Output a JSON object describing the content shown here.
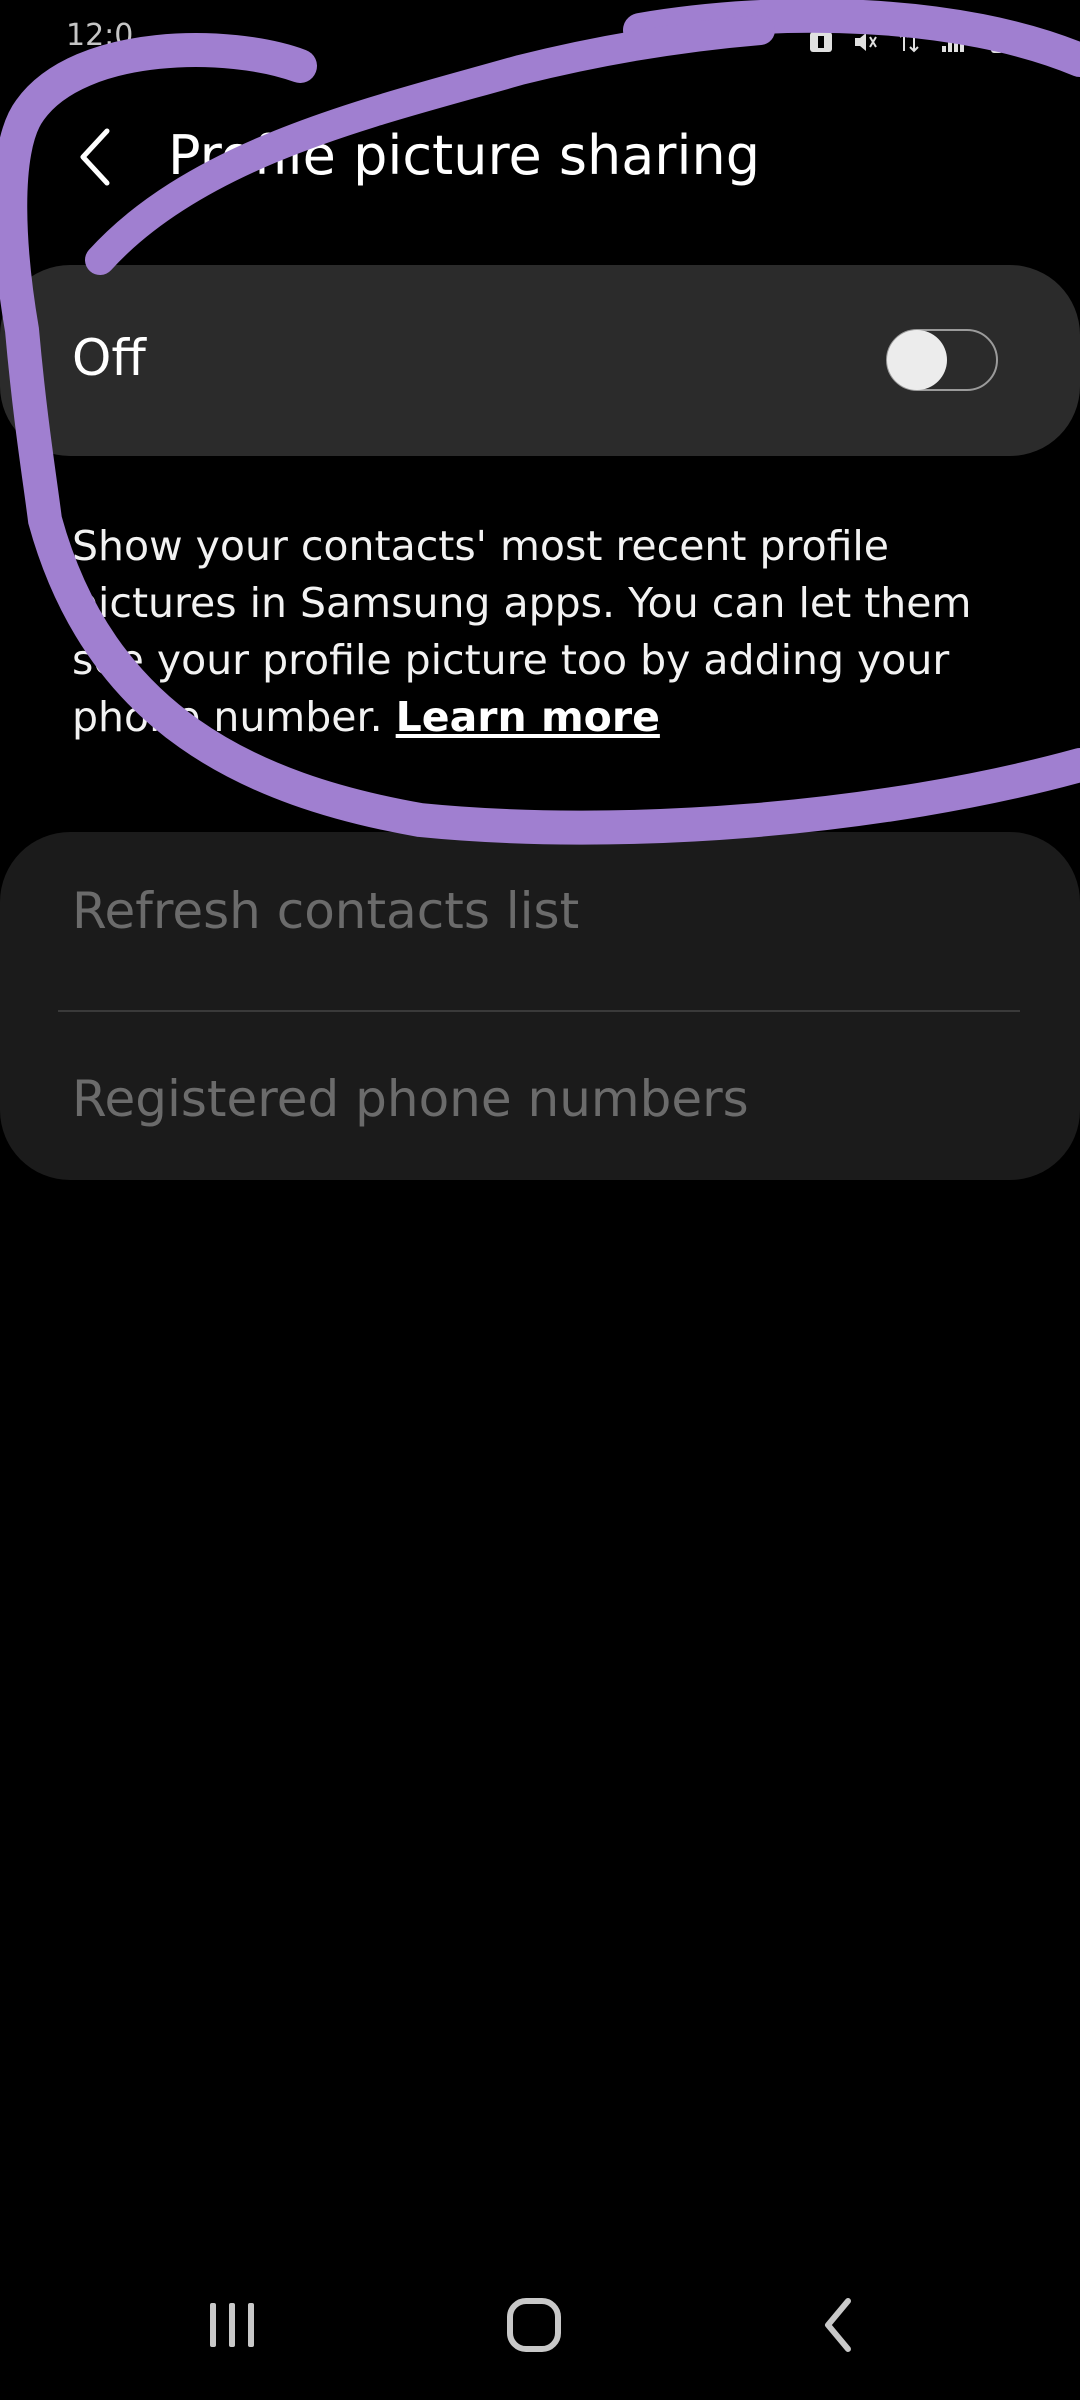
{
  "status_bar": {
    "time": "12:0"
  },
  "header": {
    "title": "Profile picture sharing"
  },
  "toggle": {
    "label": "Off",
    "state": false
  },
  "description": {
    "text": "Show your contacts' most recent profile pictures in Samsung apps. You can let them see your profile picture too by adding your phone number.",
    "link_label": "Learn more"
  },
  "list": {
    "items": [
      {
        "label": "Refresh contacts list"
      },
      {
        "label": "Registered phone numbers"
      }
    ]
  },
  "annotation": {
    "color": "#a07fd0"
  },
  "nav": {
    "icons": [
      "recents-icon",
      "home-icon",
      "back-icon"
    ]
  }
}
